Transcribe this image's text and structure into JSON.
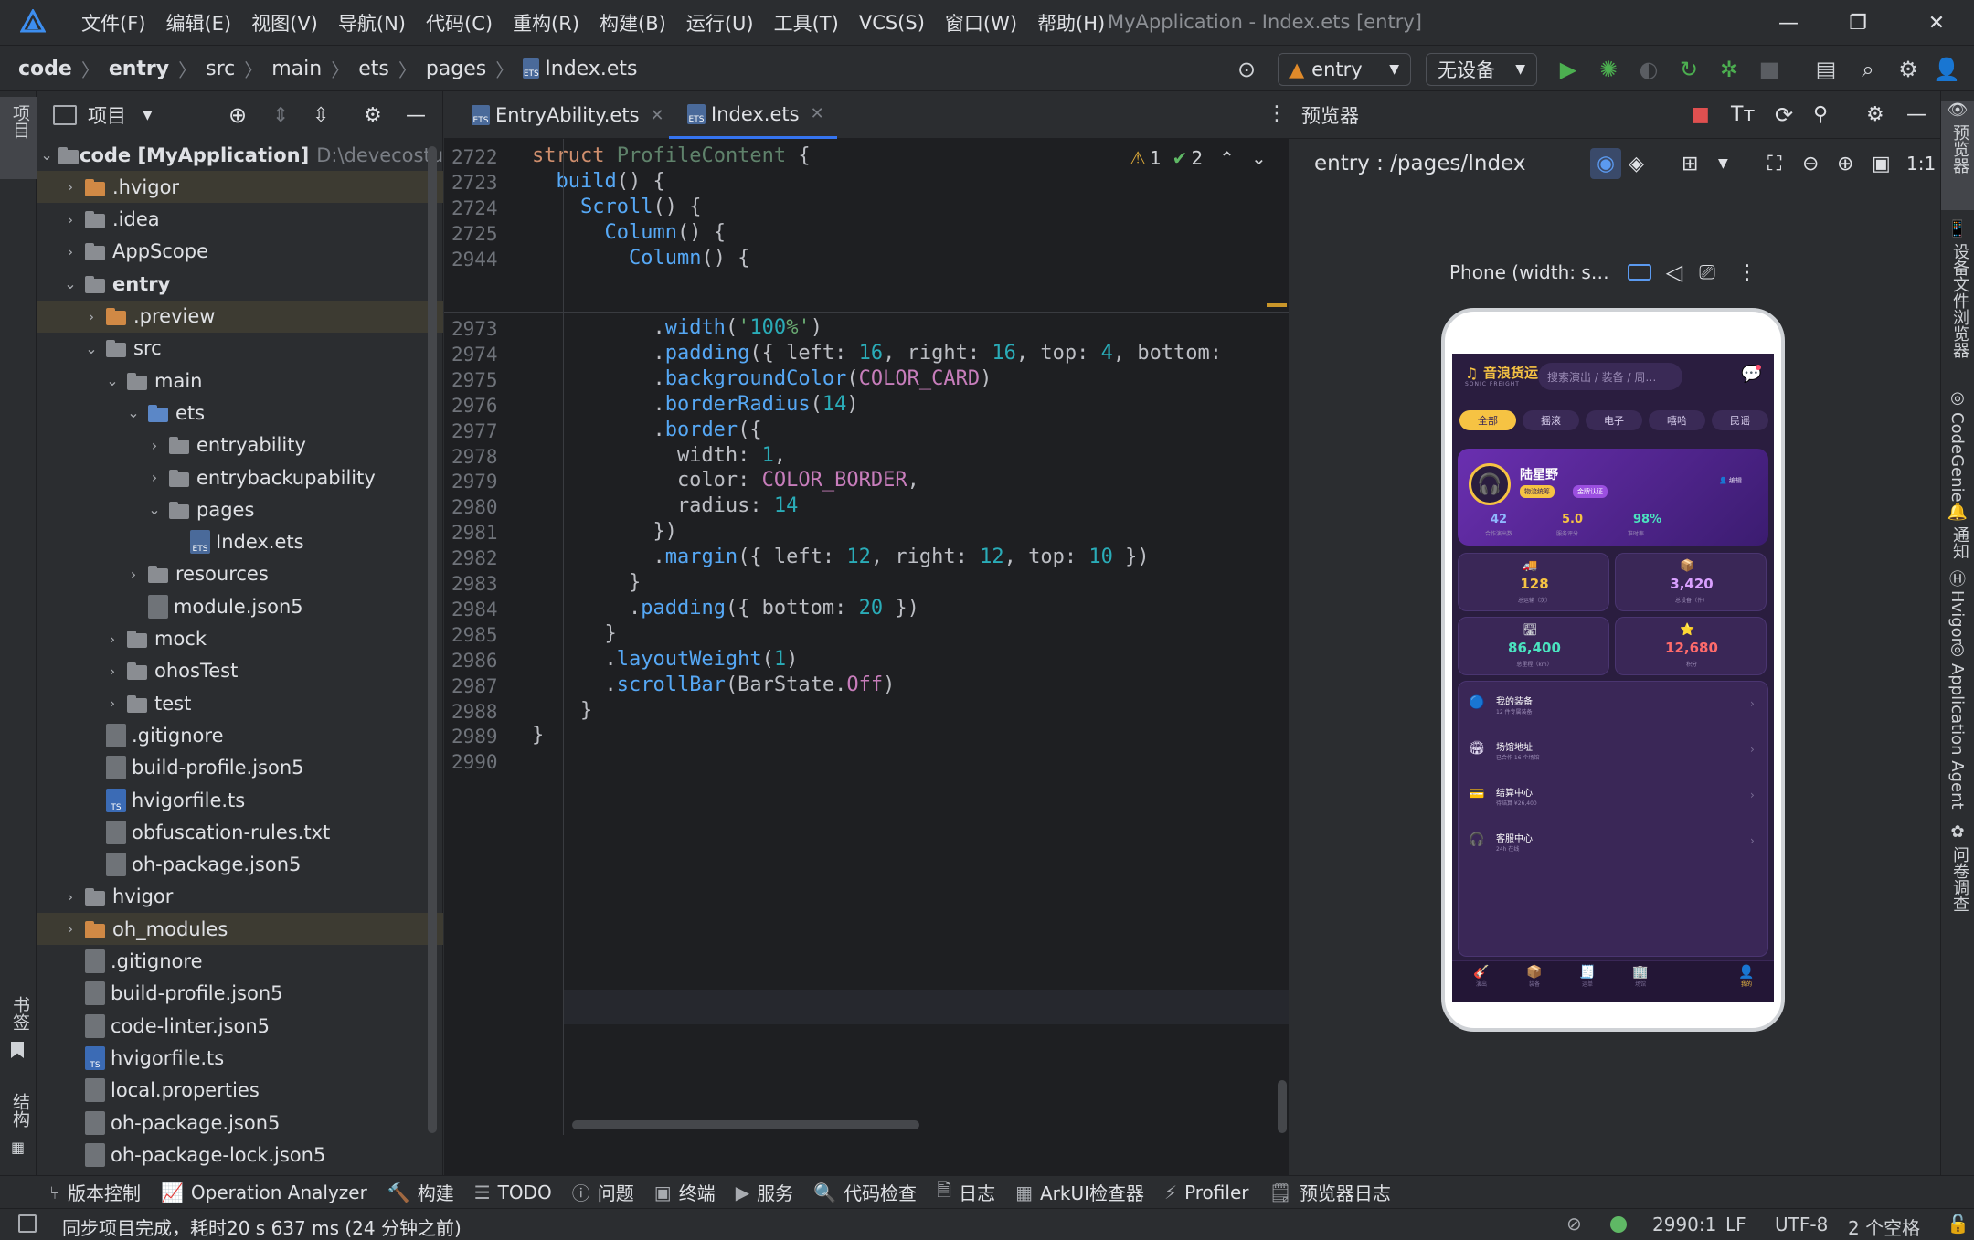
{
  "window": {
    "title": "MyApplication - Index.ets [entry]",
    "menu": [
      "文件(F)",
      "编辑(E)",
      "视图(V)",
      "导航(N)",
      "代码(C)",
      "重构(R)",
      "构建(B)",
      "运行(U)",
      "工具(T)",
      "VCS(S)",
      "窗口(W)",
      "帮助(H)"
    ]
  },
  "breadcrumb": [
    "code",
    "entry",
    "src",
    "main",
    "ets",
    "pages",
    "Index.ets"
  ],
  "toolbar": {
    "module": "entry",
    "device": "无设备"
  },
  "project": {
    "title": "项目",
    "rows": [
      {
        "label": "code [MyApplication]",
        "extra": "D:\\devecostu",
        "depth": 0,
        "arrow": "v",
        "icon": "folder",
        "bold": true
      },
      {
        "label": ".hvigor",
        "depth": 1,
        "arrow": ">",
        "icon": "folder-orange",
        "hl": true
      },
      {
        "label": ".idea",
        "depth": 1,
        "arrow": ">",
        "icon": "folder"
      },
      {
        "label": "AppScope",
        "depth": 1,
        "arrow": ">",
        "icon": "folder"
      },
      {
        "label": "entry",
        "depth": 1,
        "arrow": "v",
        "icon": "folder",
        "bold": true
      },
      {
        "label": ".preview",
        "depth": 2,
        "arrow": ">",
        "icon": "folder-orange",
        "hl": true
      },
      {
        "label": "src",
        "depth": 2,
        "arrow": "v",
        "icon": "folder"
      },
      {
        "label": "main",
        "depth": 3,
        "arrow": "v",
        "icon": "folder"
      },
      {
        "label": "ets",
        "depth": 4,
        "arrow": "v",
        "icon": "folder-blue"
      },
      {
        "label": "entryability",
        "depth": 5,
        "arrow": ">",
        "icon": "folder"
      },
      {
        "label": "entrybackupability",
        "depth": 5,
        "arrow": ">",
        "icon": "folder"
      },
      {
        "label": "pages",
        "depth": 5,
        "arrow": "v",
        "icon": "folder"
      },
      {
        "label": "Index.ets",
        "depth": 6,
        "arrow": "",
        "icon": "ets"
      },
      {
        "label": "resources",
        "depth": 4,
        "arrow": ">",
        "icon": "folder"
      },
      {
        "label": "module.json5",
        "depth": 4,
        "arrow": "",
        "icon": "json"
      },
      {
        "label": "mock",
        "depth": 3,
        "arrow": ">",
        "icon": "folder"
      },
      {
        "label": "ohosTest",
        "depth": 3,
        "arrow": ">",
        "icon": "folder"
      },
      {
        "label": "test",
        "depth": 3,
        "arrow": ">",
        "icon": "folder"
      },
      {
        "label": ".gitignore",
        "depth": 2,
        "arrow": "",
        "icon": "file"
      },
      {
        "label": "build-profile.json5",
        "depth": 2,
        "arrow": "",
        "icon": "json"
      },
      {
        "label": "hvigorfile.ts",
        "depth": 2,
        "arrow": "",
        "icon": "ts"
      },
      {
        "label": "obfuscation-rules.txt",
        "depth": 2,
        "arrow": "",
        "icon": "file"
      },
      {
        "label": "oh-package.json5",
        "depth": 2,
        "arrow": "",
        "icon": "json"
      },
      {
        "label": "hvigor",
        "depth": 1,
        "arrow": ">",
        "icon": "folder"
      },
      {
        "label": "oh_modules",
        "depth": 1,
        "arrow": ">",
        "icon": "folder-orange",
        "hl": true
      },
      {
        "label": ".gitignore",
        "depth": 1,
        "arrow": "",
        "icon": "file"
      },
      {
        "label": "build-profile.json5",
        "depth": 1,
        "arrow": "",
        "icon": "json"
      },
      {
        "label": "code-linter.json5",
        "depth": 1,
        "arrow": "",
        "icon": "json"
      },
      {
        "label": "hvigorfile.ts",
        "depth": 1,
        "arrow": "",
        "icon": "ts"
      },
      {
        "label": "local.properties",
        "depth": 1,
        "arrow": "",
        "icon": "props"
      },
      {
        "label": "oh-package.json5",
        "depth": 1,
        "arrow": "",
        "icon": "json"
      },
      {
        "label": "oh-package-lock.json5",
        "depth": 1,
        "arrow": "",
        "icon": "json"
      }
    ]
  },
  "editor": {
    "tabs": [
      "EntryAbility.ets",
      "Index.ets"
    ],
    "inspections": {
      "warnings": "1",
      "ok": "2"
    },
    "sticky": [
      {
        "ln": "2722",
        "code": "struct ProfileContent {"
      },
      {
        "ln": "2723",
        "code": "  build() {"
      },
      {
        "ln": "2724",
        "code": "    Scroll() {"
      },
      {
        "ln": "2725",
        "code": "      Column() {"
      },
      {
        "ln": "2944",
        "code": "        Column() {"
      }
    ],
    "lines": [
      {
        "ln": "2973",
        "code": "          .width('100%')"
      },
      {
        "ln": "2974",
        "code": "          .padding({ left: 16, right: 16, top: 4, bottom: "
      },
      {
        "ln": "2975",
        "code": "          .backgroundColor(COLOR_CARD)"
      },
      {
        "ln": "2976",
        "code": "          .borderRadius(14)"
      },
      {
        "ln": "2977",
        "code": "          .border({"
      },
      {
        "ln": "2978",
        "code": "            width: 1,"
      },
      {
        "ln": "2979",
        "code": "            color: COLOR_BORDER,"
      },
      {
        "ln": "2980",
        "code": "            radius: 14"
      },
      {
        "ln": "2981",
        "code": "          })"
      },
      {
        "ln": "2982",
        "code": "          .margin({ left: 12, right: 12, top: 10 })"
      },
      {
        "ln": "2983",
        "code": "        }"
      },
      {
        "ln": "2984",
        "code": "        .padding({ bottom: 20 })"
      },
      {
        "ln": "2985",
        "code": "      }"
      },
      {
        "ln": "2986",
        "code": "      .layoutWeight(1)"
      },
      {
        "ln": "2987",
        "code": "      .scrollBar(BarState.Off)"
      },
      {
        "ln": "2988",
        "code": "    }"
      },
      {
        "ln": "2989",
        "code": "}"
      },
      {
        "ln": "2990",
        "code": ""
      }
    ]
  },
  "preview": {
    "title": "预览器",
    "route": "entry : /pages/Index",
    "device": "Phone (width: s…",
    "app": {
      "brand": "音浪货运",
      "brand_sub": "SONIC FREIGHT",
      "search": "搜索演出 / 装备 / 周…",
      "chips": [
        "全部",
        "摇滚",
        "电子",
        "嘻哈",
        "民谣"
      ],
      "user": "陆星野",
      "badge1": "物流统筹",
      "badge2": "金牌认证",
      "edit": "编辑",
      "stats": [
        {
          "v": "42",
          "l": "合作演出数"
        },
        {
          "v": "5.0",
          "l": "服务评分"
        },
        {
          "v": "98%",
          "l": "准时率"
        }
      ],
      "tiles": [
        {
          "v": "128",
          "l": "总运输（次）"
        },
        {
          "v": "3,420",
          "l": "总设备（件）"
        },
        {
          "v": "86,400",
          "l": "总里程（km）"
        },
        {
          "v": "12,680",
          "l": "积分"
        }
      ],
      "menu": [
        {
          "t": "我的装备",
          "s": "12 件专属装备"
        },
        {
          "t": "场馆地址",
          "s": "已合作 16 个场馆"
        },
        {
          "t": "结算中心",
          "s": "待结算 ¥26,400"
        },
        {
          "t": "客服中心",
          "s": "24h 在线"
        }
      ],
      "nav": [
        "演出",
        "装备",
        "运单",
        "场馆",
        "我的"
      ]
    }
  },
  "rightstrip": [
    "预览器",
    "设备文件浏览器",
    "CodeGenie",
    "通知",
    "Hvigor",
    "Application Agent",
    "问卷调查"
  ],
  "leftstrip": [
    "项目",
    "书签",
    "结构"
  ],
  "bottomtabs": [
    "版本控制",
    "Operation Analyzer",
    "构建",
    "TODO",
    "问题",
    "终端",
    "服务",
    "代码检查",
    "日志",
    "ArkUI检查器",
    "Profiler",
    "预览器日志"
  ],
  "status": {
    "message": "同步项目完成，耗时20 s 637 ms (24 分钟之前)",
    "position": "2990:1",
    "eol": "LF",
    "encoding": "UTF-8",
    "indent": "2 个空格"
  }
}
